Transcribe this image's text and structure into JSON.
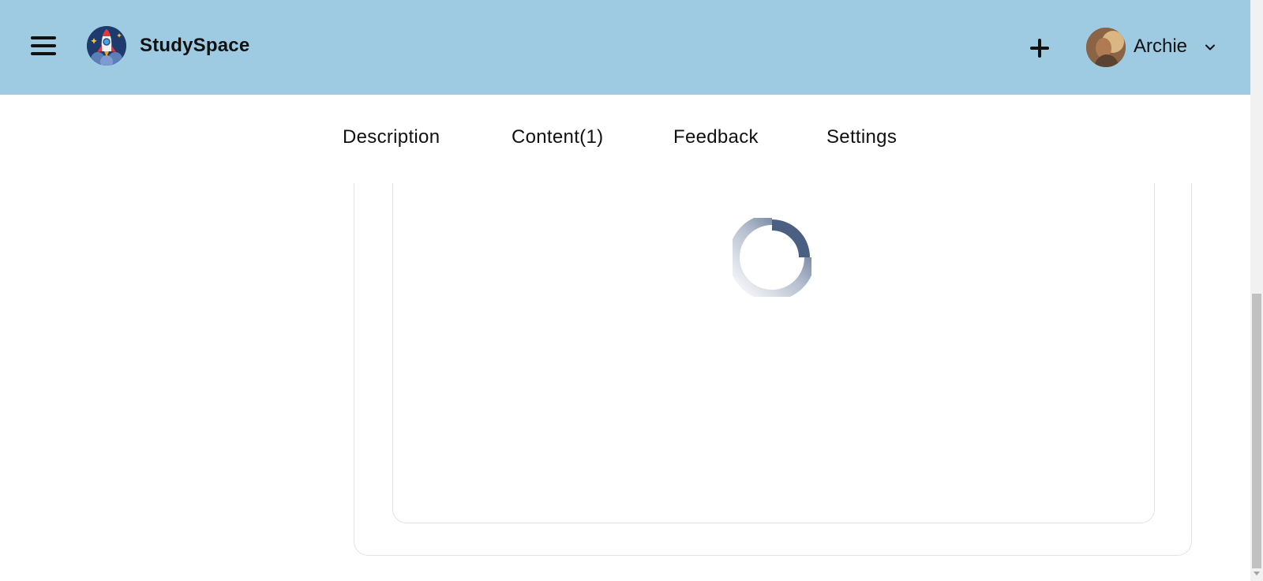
{
  "app": {
    "brand": "StudySpace",
    "colors": {
      "header_bg": "#9ecae2",
      "spinner": "#4a5f82"
    }
  },
  "header": {
    "menu_icon": "hamburger-menu-icon",
    "logo_icon": "rocket-logo-icon",
    "add_icon": "plus-icon",
    "user": {
      "name": "Archie",
      "dropdown_icon": "chevron-down-icon"
    }
  },
  "tabs": [
    {
      "label": "Description"
    },
    {
      "label": "Content(1)"
    },
    {
      "label": "Feedback"
    },
    {
      "label": "Settings"
    }
  ],
  "main": {
    "loading": true,
    "spinner_icon": "loading-spinner-icon"
  }
}
